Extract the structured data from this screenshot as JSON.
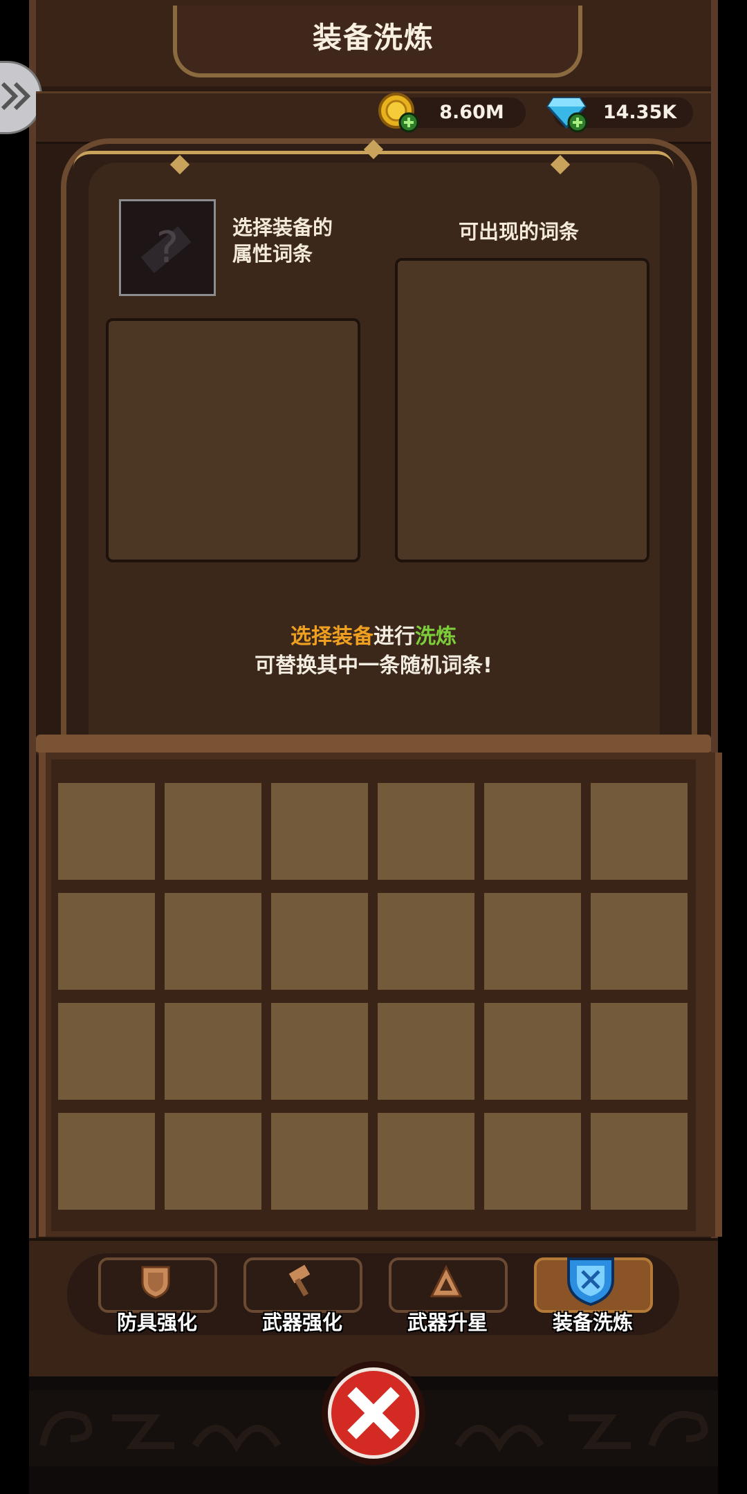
{
  "header": {
    "title": "装备洗炼"
  },
  "currencies": [
    {
      "name": "gold",
      "value": "8.60M",
      "icon": "gold-coin-icon",
      "plus_icon": "plus-icon"
    },
    {
      "name": "diamond",
      "value": "14.35K",
      "icon": "diamond-icon",
      "plus_icon": "plus-icon"
    }
  ],
  "select_panel": {
    "select_label_line1": "选择装备的",
    "select_label_line2": "属性词条",
    "possible_label": "可出现的词条",
    "hint_part1": "选择装备",
    "hint_part2": "进行",
    "hint_part3": "洗炼",
    "hint_line2": "可替换其中一条随机词条!"
  },
  "inventory": {
    "rows": 4,
    "cols": 6
  },
  "tabs": [
    {
      "label": "防具强化",
      "icon": "shield-icon",
      "active": false
    },
    {
      "label": "武器强化",
      "icon": "hammer-icon",
      "active": false
    },
    {
      "label": "武器升星",
      "icon": "triangle-icon",
      "active": false
    },
    {
      "label": "装备洗炼",
      "icon": "blue-shield-icon",
      "active": true
    }
  ],
  "footer": {
    "close_icon": "close-icon"
  },
  "colors": {
    "accent_orange": "#f0a020",
    "accent_green": "#7ccf3a",
    "close_red": "#d32a24"
  }
}
